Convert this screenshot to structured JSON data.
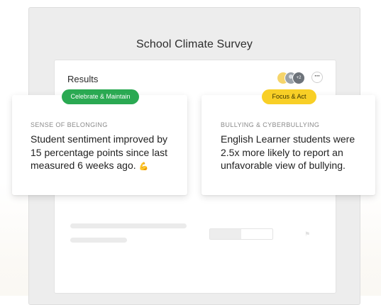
{
  "survey": {
    "title": "School Climate Survey"
  },
  "results": {
    "title": "Results",
    "avatar_overflow": "+2",
    "more_label": "···"
  },
  "cards": [
    {
      "badge": "Celebrate & Maintain",
      "badge_color": "#2aa952",
      "category": "SENSE OF BELONGING",
      "text": "Student sentiment improved by 15 percentage points since last measured 6 weeks ago.",
      "emoji": "💪"
    },
    {
      "badge": "Focus & Act",
      "badge_color": "#f8cf26",
      "category": "BULLYING & CYBERBULLYING",
      "text": "English Learner students were 2.5x more likely to report an unfavorable view of bullying."
    }
  ],
  "placeholder": {
    "bar_fill_fraction": 0.5
  }
}
